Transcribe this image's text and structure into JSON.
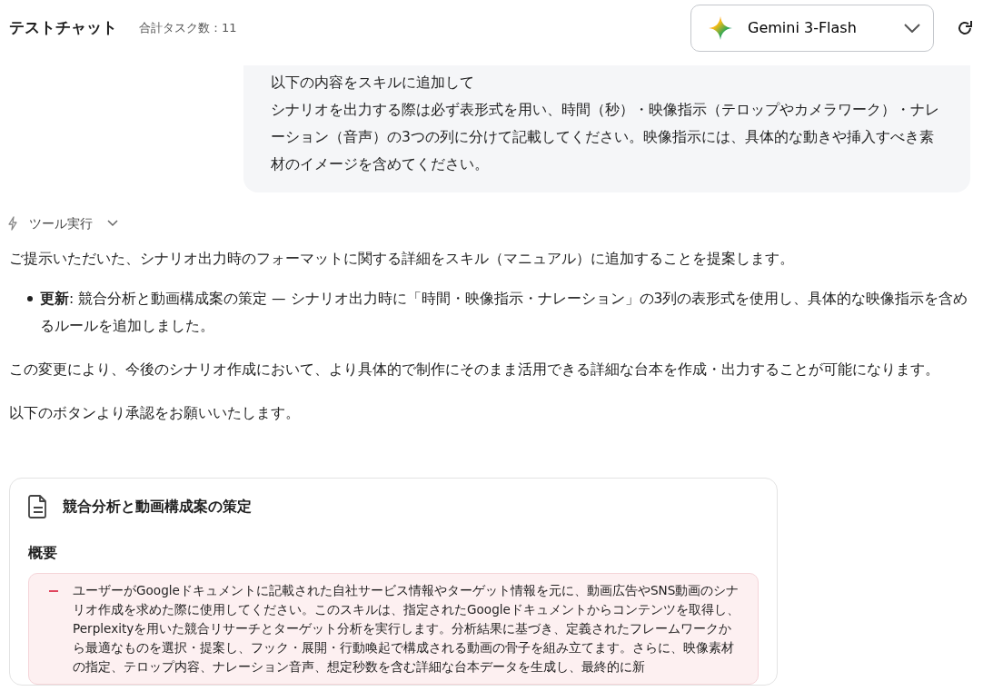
{
  "header": {
    "title": "テストチャット",
    "task_count": "合計タスク数：11",
    "model": "Gemini 3-Flash"
  },
  "user_message": {
    "lines": [
      "以下の内容をスキルに追加して",
      "シナリオを出力する際は必ず表形式を用い、時間（秒）・映像指示（テロップやカメラワーク）・ナレーション（音声）の3つの列に分けて記載してください。映像指示には、具体的な動きや挿入すべき素材のイメージを含めてください。"
    ]
  },
  "tool_call": {
    "label": "ツール実行",
    "expanded": false
  },
  "reply": {
    "intro": "ご提示いただいた、シナリオ出力時のフォーマットに関する詳細をスキル（マニュアル）に追加することを提案します。",
    "bullets": [
      "**更新**: 競合分析と動画構成案の策定 — シナリオ出力時に「時間・映像指示・ナレーション」の3列の表形式を使用し、具体的な映像指示を含めるルールを追加しました。"
    ],
    "paragraphs": [
      "この変更により、今後のシナリオ作成において、より具体的で制作にそのまま活用できる詳細な台本を作成・出力することが可能になります。",
      "以下のボタンより承認をお願いいたします。"
    ]
  },
  "skill_card": {
    "title": "競合分析と動画構成案の策定",
    "section": "概要",
    "diff": [
      {
        "kind": "removed",
        "text": "ユーザーがGoogleドキュメントに記載された自社サービス情報やターゲット情報を元に、動画広告やSNS動画のシナリオ作成を求めた際に使用してください。このスキルは、指定されたGoogleドキュメントからコンテンツを取得し、Perplexityを用いた競合リサーチとターゲット分析を実行します。分析結果に基づき、定義されたフレームワークから最適なものを選択・提案し、フック・展開・行動喚起で構成される動画の骨子を組み立てます。さらに、映像素材の指定、テロップ内容、ナレーション音声、想定秒数を含む詳細な台本データを生成し、最終的に新"
      }
    ]
  }
}
